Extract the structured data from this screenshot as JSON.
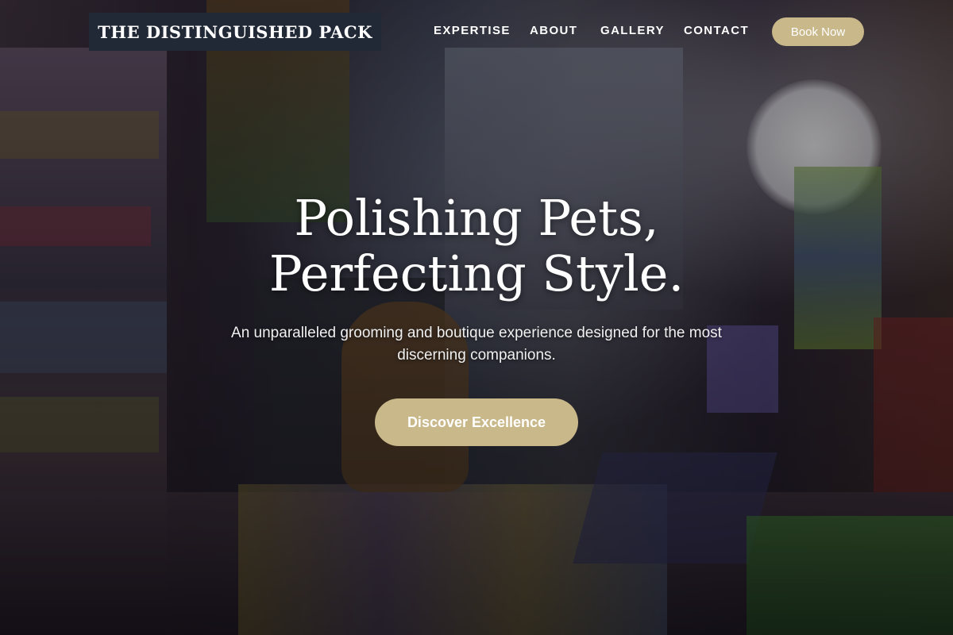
{
  "brand": {
    "name": "THE DISTINGUISHED PACK"
  },
  "nav": {
    "items": [
      {
        "label": "EXPERTISE"
      },
      {
        "label": "ABOUT"
      },
      {
        "label": "GALLERY"
      },
      {
        "label": "CONTACT"
      }
    ],
    "book_label": "Book Now"
  },
  "hero": {
    "title_line1": "Polishing Pets,",
    "title_line2": "Perfecting Style.",
    "subtitle": "An unparalleled grooming and boutique experience designed for the most discerning companions.",
    "cta_label": "Discover Excellence"
  },
  "colors": {
    "accent": "#c9b88a",
    "brand_bg": "#212836",
    "text": "#ffffff"
  }
}
